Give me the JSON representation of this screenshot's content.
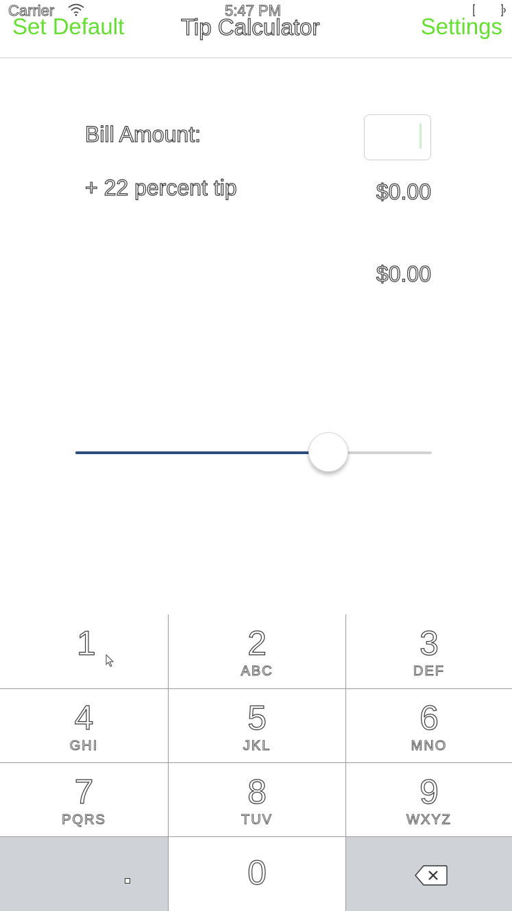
{
  "status_bar": {
    "carrier": "Carrier",
    "time": "5:47 PM",
    "wifi_icon": "wifi-icon",
    "battery_icon": "battery-icon"
  },
  "nav": {
    "left_button": "Set Default",
    "title": "Tip Calculator",
    "right_button": "Settings",
    "accent_color": "#66dd33"
  },
  "form": {
    "bill_label": "Bill Amount:",
    "bill_value": "",
    "tip_label": "+ 22 percent tip",
    "tip_amount": "$0.00",
    "total_amount": "$0.00"
  },
  "slider": {
    "value_fraction": 0.71,
    "fill_color": "#2c4e7d"
  },
  "keypad": {
    "keys": [
      {
        "num": "1",
        "letters": ""
      },
      {
        "num": "2",
        "letters": "ABC"
      },
      {
        "num": "3",
        "letters": "DEF"
      },
      {
        "num": "4",
        "letters": "GHI"
      },
      {
        "num": "5",
        "letters": "JKL"
      },
      {
        "num": "6",
        "letters": "MNO"
      },
      {
        "num": "7",
        "letters": "PQRS"
      },
      {
        "num": "8",
        "letters": "TUV"
      },
      {
        "num": "9",
        "letters": "WXYZ"
      },
      {
        "num": "0",
        "letters": ""
      }
    ],
    "decimal_key_icon": "decimal-point-icon",
    "delete_key_icon": "backspace-icon"
  }
}
